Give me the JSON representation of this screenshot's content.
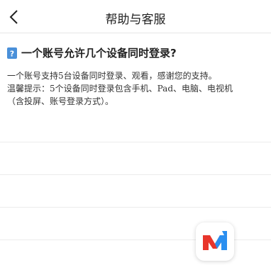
{
  "header": {
    "title": "帮助与客服"
  },
  "faq": {
    "question": "一个账号允许几个设备同时登录?",
    "answer_lines": [
      "一个账号支持5台设备同时登录、观看，感谢您的支持。",
      "温馨提示：5个设备同时登录包含手机、Pad、电脑、电视机",
      "（含投屏、账号登录方式）。"
    ]
  },
  "icons": {
    "back": "chevron-left-icon",
    "question": "question-badge-icon",
    "app": "app-logo-icon"
  },
  "colors": {
    "question_badge": "#4a90d9",
    "logo_red": "#e8352b",
    "logo_blue": "#2a8ff0"
  }
}
